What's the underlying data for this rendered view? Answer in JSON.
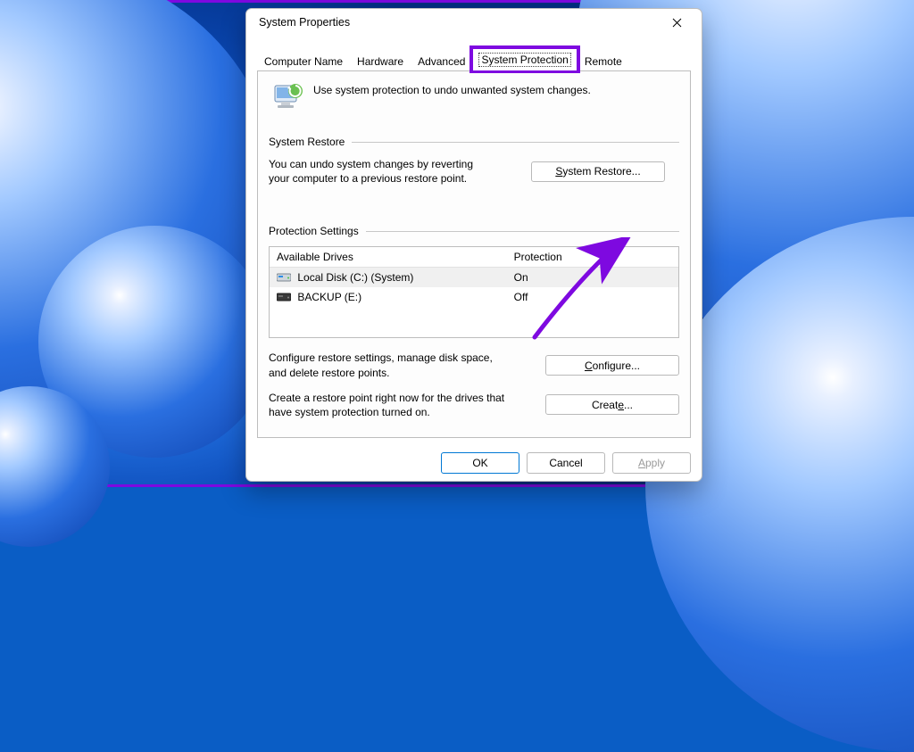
{
  "dialog": {
    "title": "System Properties",
    "tabs": {
      "computer_name": "Computer Name",
      "hardware": "Hardware",
      "advanced": "Advanced",
      "system_protection": "System Protection",
      "remote": "Remote"
    },
    "intro_text": "Use system protection to undo unwanted system changes.",
    "restore_group": {
      "title": "System Restore",
      "description": "You can undo system changes by reverting your computer to a previous restore point.",
      "button_pre": "S",
      "button_post": "ystem Restore..."
    },
    "protection_group": {
      "title": "Protection Settings",
      "columns": {
        "drives": "Available Drives",
        "protection": "Protection"
      },
      "rows": [
        {
          "name": "Local Disk (C:) (System)",
          "protection": "On",
          "icon": "disk-c-blue",
          "selected": true
        },
        {
          "name": "BACKUP (E:)",
          "protection": "Off",
          "icon": "disk-e-gray",
          "selected": false
        }
      ],
      "configure_text": "Configure restore settings, manage disk space, and delete restore points.",
      "configure_button_pre": "C",
      "configure_button_post": "onfigure...",
      "create_text": "Create a restore point right now for the drives that have system protection turned on.",
      "create_button_pre": "Creat",
      "create_button_post": "..."
    },
    "buttons": {
      "ok": "OK",
      "cancel": "Cancel",
      "apply_pre": "A",
      "apply_post": "pply"
    }
  },
  "colors": {
    "accent": "#7e09e0"
  }
}
